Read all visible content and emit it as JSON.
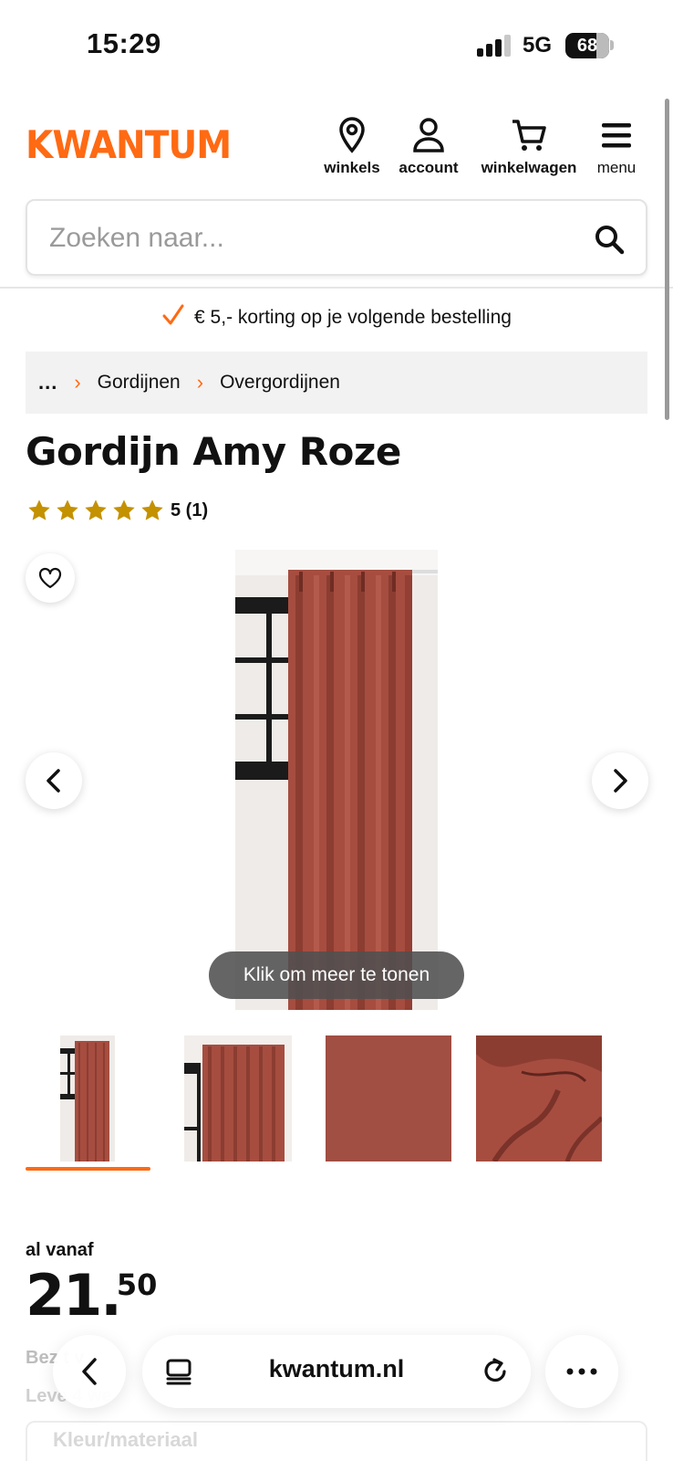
{
  "status_bar": {
    "time": "15:29",
    "network": "5G",
    "battery": "68"
  },
  "header": {
    "logo": "KWANTUM",
    "nav": [
      {
        "label": "winkels",
        "icon": "location-pin-icon"
      },
      {
        "label": "account",
        "icon": "user-icon"
      },
      {
        "label": "winkelwagen",
        "icon": "cart-icon"
      },
      {
        "label": "menu",
        "icon": "hamburger-icon"
      }
    ]
  },
  "search": {
    "placeholder": "Zoeken naar..."
  },
  "promo": {
    "text": "€ 5,- korting op je volgende bestelling"
  },
  "breadcrumb": {
    "ellipsis": "...",
    "items": [
      "Gordijnen",
      "Overgordijnen"
    ]
  },
  "product": {
    "title": "Gordijn Amy Roze",
    "rating_stars": 5,
    "rating_text": "5 (1)",
    "tooltip": "Klik om meer te tonen",
    "thumbnail_count": 4,
    "selected_thumbnail": 1,
    "price_label": "al vanaf",
    "price_main": "21.",
    "price_cents": "50",
    "delivery_line1": "Bez           t v",
    "delivery_line2": "Leve       4 we",
    "option_label": "Kleur/materiaal"
  },
  "colors": {
    "brand": "#ff6a13",
    "star": "#c49100",
    "curtain": "#a64d40"
  },
  "browser": {
    "url": "kwantum.nl"
  }
}
